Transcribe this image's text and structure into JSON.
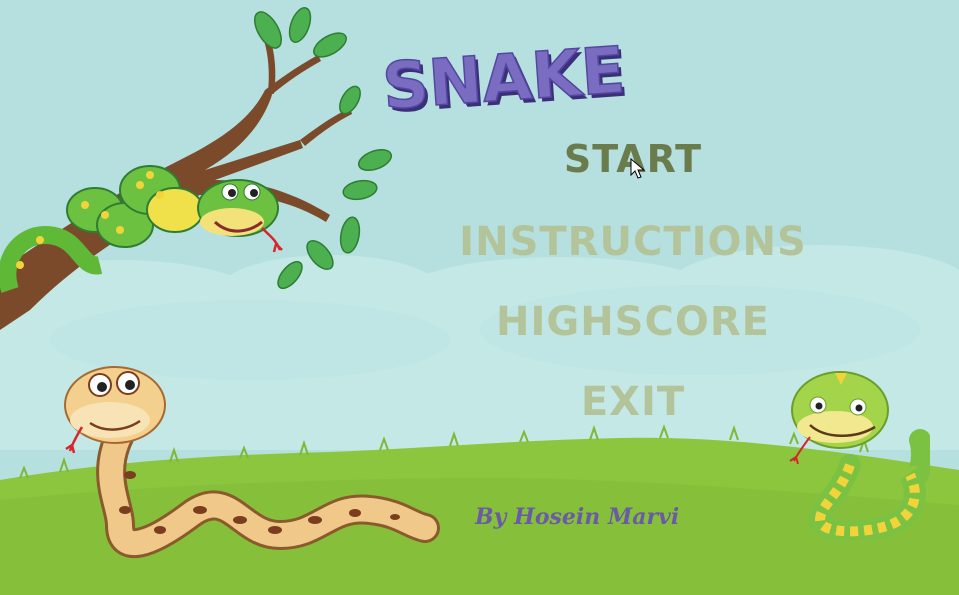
{
  "title": "SNAKE",
  "menu": {
    "start": "START",
    "instructions": "INSTRUCTIONS",
    "highscore": "HIGHSCORE",
    "exit": "EXIT"
  },
  "credit": "By Hosein Marvi",
  "colors": {
    "sky": "#b5e0df",
    "grass": "#8cc63f",
    "title": "#7a6cc0",
    "menu_active": "#6b7c4c",
    "menu_inactive": "#b3c49a",
    "credit": "#6a5ca4"
  },
  "icons": [
    "snake-on-branch",
    "coiled-brown-snake",
    "green-yellow-snake",
    "cursor-arrow"
  ]
}
